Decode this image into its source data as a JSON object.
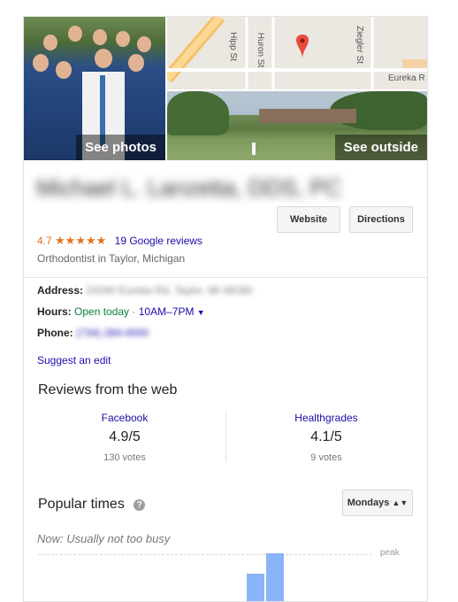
{
  "photos": {
    "see_photos": "See photos",
    "see_outside": "See outside",
    "map_streets": [
      "Hipp St",
      "Huron St",
      "Ziegler St",
      "Eureka R"
    ]
  },
  "business": {
    "name_blurred": "Michael L. Lanzetta, DDS, PC",
    "website_label": "Website",
    "directions_label": "Directions",
    "rating_value": "4.7",
    "stars": "★★★★★",
    "reviews_link": "19 Google reviews",
    "category": "Orthodontist in Taylor, Michigan"
  },
  "details": {
    "address_label": "Address:",
    "address_blurred": "24340 Eureka Rd, Taylor, MI 48180",
    "hours_label": "Hours:",
    "hours_status": "Open today",
    "hours_sep": "·",
    "hours_time": "10AM–7PM",
    "phone_label": "Phone:",
    "phone_blurred": "(734) 284-0000",
    "suggest_edit": "Suggest an edit"
  },
  "reviews_web": {
    "title": "Reviews from the web",
    "sources": [
      {
        "name": "Facebook",
        "rating": "4.9/5",
        "votes": "130 votes"
      },
      {
        "name": "Healthgrades",
        "rating": "4.1/5",
        "votes": "9 votes"
      }
    ]
  },
  "popular_times": {
    "title": "Popular times",
    "help": "?",
    "day_select": "Mondays",
    "status": "Now: Usually not too busy",
    "peak_label": "peak",
    "bars": [
      0.32,
      0.55
    ]
  },
  "colors": {
    "link": "#1a0dab",
    "rating_orange": "#e7711b",
    "open_green": "#0b8043",
    "bar_blue": "#8ab4f8"
  }
}
